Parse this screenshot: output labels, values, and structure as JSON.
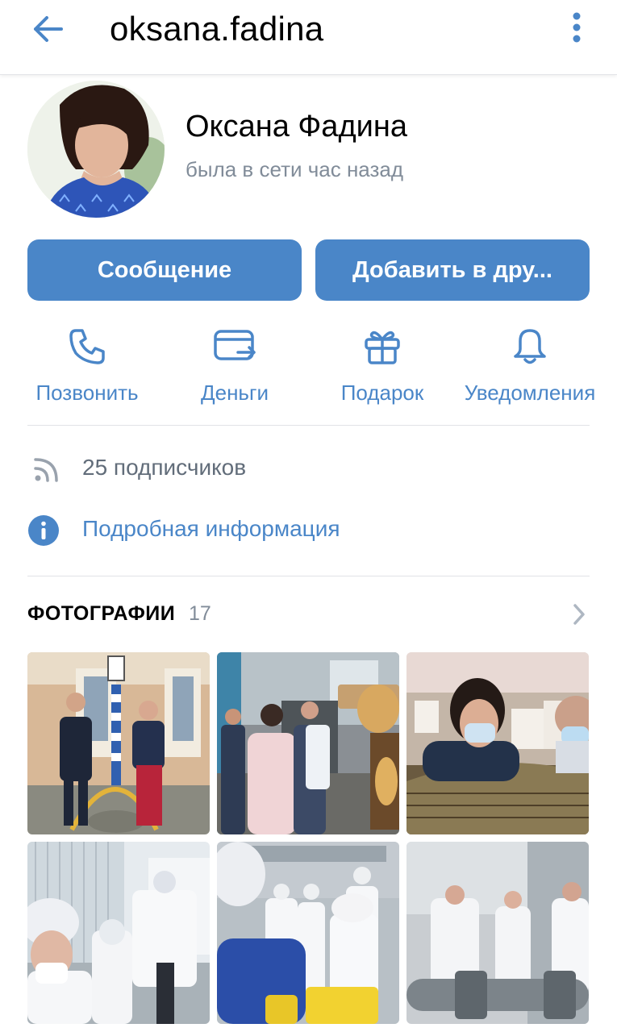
{
  "header": {
    "username": "oksana.fadina",
    "back_icon": "arrow-left-icon",
    "more_icon": "more-vertical-icon"
  },
  "profile": {
    "name": "Оксана Фадина",
    "status": "была в сети час назад"
  },
  "buttons": {
    "message": "Сообщение",
    "add_friend": "Добавить в дру..."
  },
  "actions": [
    {
      "label": "Позвонить",
      "icon": "phone-icon"
    },
    {
      "label": "Деньги",
      "icon": "money-transfer-icon"
    },
    {
      "label": "Подарок",
      "icon": "gift-icon"
    },
    {
      "label": "Уведомления",
      "icon": "bell-icon"
    }
  ],
  "info": {
    "subscribers": "25 подписчиков",
    "details": "Подробная информация"
  },
  "photos": {
    "title": "ФОТОГРАФИИ",
    "count": "17"
  },
  "colors": {
    "accent": "#4a86c8",
    "secondary_text": "#818c99",
    "divider": "#e1e3e6"
  }
}
